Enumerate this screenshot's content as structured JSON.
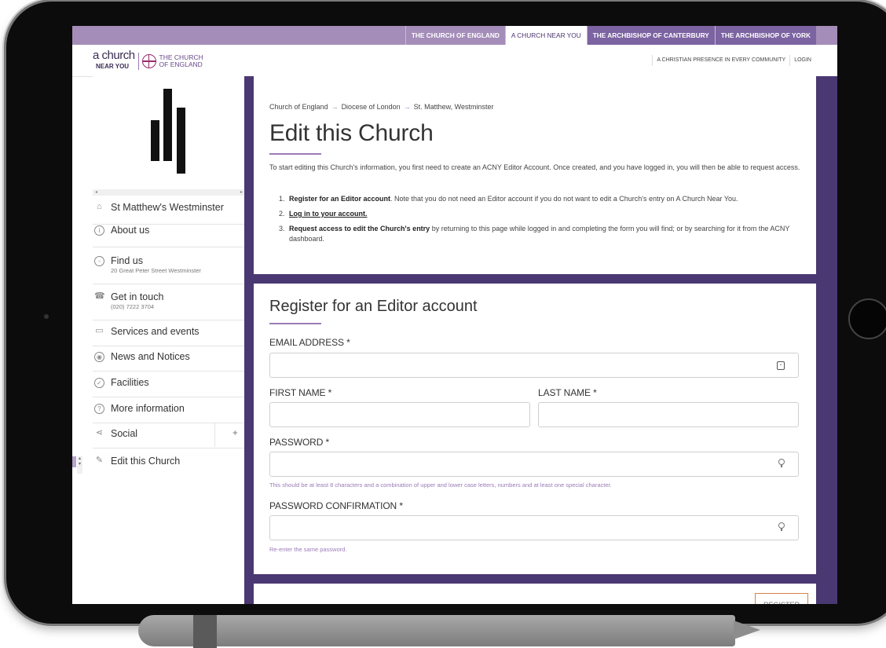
{
  "top_nav": {
    "tabs": [
      {
        "label": "THE CHURCH OF ENGLAND"
      },
      {
        "label": "A CHURCH NEAR YOU"
      },
      {
        "label": "THE ARCHBISHOP OF CANTERBURY"
      },
      {
        "label": "THE ARCHBISHOP OF YORK"
      }
    ],
    "active_tab": "A CHURCH NEAR YOU"
  },
  "brand": {
    "logo_a_church": "a church",
    "logo_near_you": "NEAR YOU",
    "logo_cofe_line1": "THE CHURCH",
    "logo_cofe_line2": "OF ENGLAND",
    "tagline_link": "A CHRISTIAN PRESENCE IN EVERY COMMUNITY",
    "login_link": "LOGIN"
  },
  "sidebar": {
    "items": [
      {
        "label": "St Matthew's Westminster",
        "icon": "home-icon"
      },
      {
        "label": "About us",
        "icon": "info-icon"
      },
      {
        "label": "Find us",
        "sub": "20 Great Peter Street Westminster",
        "icon": "compass-icon"
      },
      {
        "label": "Get in touch",
        "sub": "(020) 7222 3704",
        "icon": "phone-icon"
      },
      {
        "label": "Services and events",
        "icon": "calendar-icon"
      },
      {
        "label": "News and Notices",
        "icon": "broadcast-icon"
      },
      {
        "label": "Facilities",
        "icon": "check-circle-icon"
      },
      {
        "label": "More information",
        "icon": "question-icon"
      },
      {
        "label": "Social",
        "icon": "share-icon"
      },
      {
        "label": "Edit this Church",
        "icon": "pencil-icon"
      }
    ]
  },
  "main": {
    "breadcrumb": [
      "Church of England",
      "Diocese of London",
      "St. Matthew, Westminster"
    ],
    "breadcrumb_sep": "→",
    "title": "Edit this Church",
    "intro": "To start editing this Church's information, you first need to create an ACNY Editor Account. Once created, and you have logged in, you will then be able to request access.",
    "steps": [
      {
        "num": "1.",
        "bold": "Register for an Editor account",
        "rest": ". Note that you do not need an Editor account if you do not want to edit a Church's entry on A Church Near You."
      },
      {
        "num": "2.",
        "bold": "Log in to your account.",
        "rest": ""
      },
      {
        "num": "3.",
        "bold": "Request access to edit the Church's entry",
        "rest": " by returning to this page while logged in and completing the form you will find; or by searching for it from the ACNY dashboard."
      }
    ]
  },
  "form": {
    "title": "Register for an Editor account",
    "email_label": "EMAIL ADDRESS *",
    "email_value": "",
    "first_name_label": "FIRST NAME *",
    "first_name_value": "",
    "last_name_label": "LAST NAME *",
    "last_name_value": "",
    "password_label": "PASSWORD *",
    "password_value": "",
    "password_hint": "This should be at least 8 characters and a combination of upper and lower case letters, numbers and at least one special character.",
    "password_confirm_label": "PASSWORD CONFIRMATION *",
    "password_confirm_value": "",
    "password_confirm_hint": "Re-enter the same password.",
    "register_button": "REGISTER"
  },
  "colors": {
    "nav_purple": "#a48db9",
    "main_purple": "#4a3872",
    "accent": "#9b7cb8",
    "button_border": "#d9824a"
  }
}
